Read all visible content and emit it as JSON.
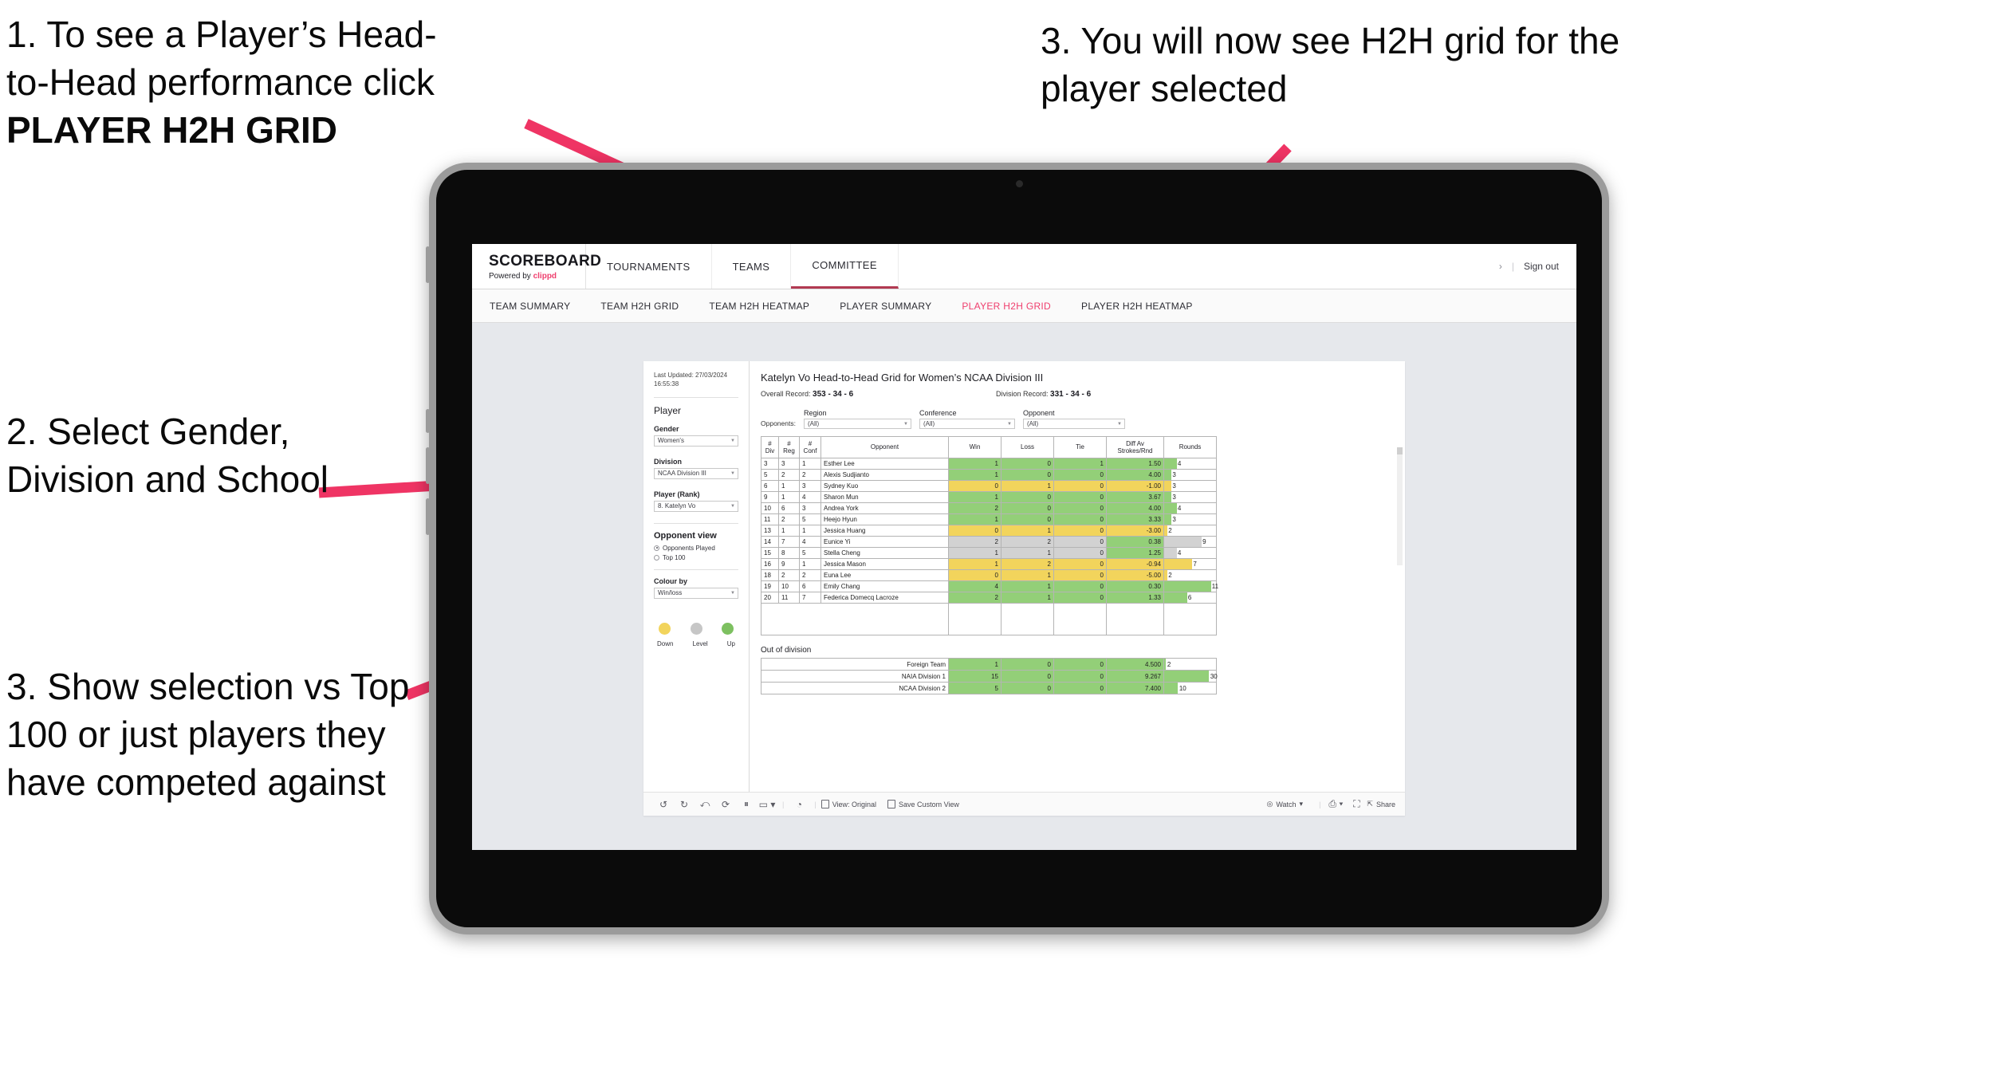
{
  "annotations": {
    "a1_line1": "1. To see a Player’s Head-",
    "a1_line2": "to-Head performance click",
    "a1_bold": "PLAYER H2H GRID",
    "a2": "2. Select Gender, Division and School",
    "a3": "3. Show selection vs Top 100 or just players they have competed against",
    "a4": "3. You will now see H2H grid for the player selected"
  },
  "colors": {
    "accent_pink": "#ef3e6d",
    "arrow_pink": "#ef3464",
    "win_green": "#93cf78",
    "loss_yellow": "#f2d45c",
    "tie_grey": "#d2d2d2",
    "active_tab": "#ef3e6d"
  },
  "browser": {
    "brand": {
      "logo": "SCOREBOARD",
      "powered_prefix": "Powered by ",
      "powered_brand": "clippd"
    },
    "topnav": [
      {
        "label": "TOURNAMENTS",
        "active": false
      },
      {
        "label": "TEAMS",
        "active": false
      },
      {
        "label": "COMMITTEE",
        "active": true
      }
    ],
    "signout": {
      "chevron": "›",
      "divider": "|",
      "label": "Sign out"
    },
    "subnav": [
      {
        "label": "TEAM SUMMARY",
        "active": false
      },
      {
        "label": "TEAM H2H GRID",
        "active": false
      },
      {
        "label": "TEAM H2H HEATMAP",
        "active": false
      },
      {
        "label": "PLAYER SUMMARY",
        "active": false
      },
      {
        "label": "PLAYER H2H GRID",
        "active": true
      },
      {
        "label": "PLAYER H2H HEATMAP",
        "active": false
      }
    ]
  },
  "rail": {
    "last_updated_line1": "Last Updated: 27/03/2024",
    "last_updated_line2": "16:55:38",
    "section_player": "Player",
    "filters": [
      {
        "label": "Gender",
        "value": "Women's"
      },
      {
        "label": "Division",
        "value": "NCAA Division III"
      },
      {
        "label": "Player (Rank)",
        "value": "8. Katelyn Vo"
      }
    ],
    "opponent_view": {
      "title": "Opponent view",
      "options": [
        {
          "label": "Opponents Played",
          "selected": true
        },
        {
          "label": "Top 100",
          "selected": false
        }
      ]
    },
    "colour_by": {
      "label": "Colour by",
      "value": "Win/loss"
    },
    "legend": [
      {
        "label": "Down",
        "color": "#f2d45c"
      },
      {
        "label": "Level",
        "color": "#c6c6c6"
      },
      {
        "label": "Up",
        "color": "#7dc060"
      }
    ]
  },
  "viz": {
    "title": "Katelyn Vo Head-to-Head Grid for Women’s NCAA Division III",
    "overall_record_label": "Overall Record: ",
    "overall_record_value": "353 -  34 - 6",
    "division_record_label": "Division Record: ",
    "division_record_value": "331 -  34 - 6",
    "opponents_label": "Opponents:",
    "opponent_filters": [
      {
        "label": "Region",
        "value": "(All)"
      },
      {
        "label": "Conference",
        "value": "(All)"
      },
      {
        "label": "Opponent",
        "value": "(All)"
      }
    ],
    "table_headers": {
      "div": "#\nDiv",
      "div_l1": "#",
      "div_l2": "Div",
      "reg_l1": "#",
      "reg_l2": "Reg",
      "conf_l1": "#",
      "conf_l2": "Conf",
      "opponent": "Opponent",
      "win": "Win",
      "loss": "Loss",
      "tie": "Tie",
      "diff_l1": "Diff Av",
      "diff_l2": "Strokes/Rnd",
      "rounds": "Rounds"
    },
    "rows": [
      {
        "div": "3",
        "reg": "3",
        "conf": "1",
        "opponent": "Esther Lee",
        "win": "1",
        "loss": "0",
        "tie": "1",
        "diff": "1.50",
        "rounds": "4",
        "color": "g",
        "rounds_pct": 24
      },
      {
        "div": "5",
        "reg": "2",
        "conf": "2",
        "opponent": "Alexis Sudjianto",
        "win": "1",
        "loss": "0",
        "tie": "0",
        "diff": "4.00",
        "rounds": "3",
        "color": "g",
        "rounds_pct": 14
      },
      {
        "div": "6",
        "reg": "1",
        "conf": "3",
        "opponent": "Sydney Kuo",
        "win": "0",
        "loss": "1",
        "tie": "0",
        "diff": "-1.00",
        "rounds": "3",
        "color": "y",
        "rounds_pct": 14
      },
      {
        "div": "9",
        "reg": "1",
        "conf": "4",
        "opponent": "Sharon Mun",
        "win": "1",
        "loss": "0",
        "tie": "0",
        "diff": "3.67",
        "rounds": "3",
        "color": "g",
        "rounds_pct": 14
      },
      {
        "div": "10",
        "reg": "6",
        "conf": "3",
        "opponent": "Andrea York",
        "win": "2",
        "loss": "0",
        "tie": "0",
        "diff": "4.00",
        "rounds": "4",
        "color": "g",
        "rounds_pct": 24
      },
      {
        "div": "11",
        "reg": "2",
        "conf": "5",
        "opponent": "Heejo Hyun",
        "win": "1",
        "loss": "0",
        "tie": "0",
        "diff": "3.33",
        "rounds": "3",
        "color": "g",
        "rounds_pct": 14
      },
      {
        "div": "13",
        "reg": "1",
        "conf": "1",
        "opponent": "Jessica Huang",
        "win": "0",
        "loss": "1",
        "tie": "0",
        "diff": "-3.00",
        "rounds": "2",
        "color": "y",
        "rounds_pct": 6
      },
      {
        "div": "14",
        "reg": "7",
        "conf": "4",
        "opponent": "Eunice Yi",
        "win": "2",
        "loss": "2",
        "tie": "0",
        "diff": "0.38",
        "rounds": "9",
        "color": "gr",
        "rounds_pct": 72,
        "diff_color": "g"
      },
      {
        "div": "15",
        "reg": "8",
        "conf": "5",
        "opponent": "Stella Cheng",
        "win": "1",
        "loss": "1",
        "tie": "0",
        "diff": "1.25",
        "rounds": "4",
        "color": "gr",
        "rounds_pct": 24,
        "diff_color": "g"
      },
      {
        "div": "16",
        "reg": "9",
        "conf": "1",
        "opponent": "Jessica Mason",
        "win": "1",
        "loss": "2",
        "tie": "0",
        "diff": "-0.94",
        "rounds": "7",
        "color": "y",
        "rounds_pct": 54
      },
      {
        "div": "18",
        "reg": "2",
        "conf": "2",
        "opponent": "Euna Lee",
        "win": "0",
        "loss": "1",
        "tie": "0",
        "diff": "-5.00",
        "rounds": "2",
        "color": "y",
        "rounds_pct": 6
      },
      {
        "div": "19",
        "reg": "10",
        "conf": "6",
        "opponent": "Emily Chang",
        "win": "4",
        "loss": "1",
        "tie": "0",
        "diff": "0.30",
        "rounds": "11",
        "color": "g",
        "rounds_pct": 90
      },
      {
        "div": "20",
        "reg": "11",
        "conf": "7",
        "opponent": "Federica Domecq Lacroze",
        "win": "2",
        "loss": "1",
        "tie": "0",
        "diff": "1.33",
        "rounds": "6",
        "color": "g",
        "rounds_pct": 44
      }
    ],
    "out_of_division": {
      "title": "Out of division",
      "rows": [
        {
          "name": "Foreign Team",
          "win": "1",
          "loss": "0",
          "tie": "0",
          "diff": "4.500",
          "rounds": "2",
          "color": "g",
          "rounds_pct": 3
        },
        {
          "name": "NAIA Division 1",
          "win": "15",
          "loss": "0",
          "tie": "0",
          "diff": "9.267",
          "rounds": "30",
          "color": "g",
          "rounds_pct": 86
        },
        {
          "name": "NCAA Division 2",
          "win": "5",
          "loss": "0",
          "tie": "0",
          "diff": "7.400",
          "rounds": "10",
          "color": "g",
          "rounds_pct": 26
        }
      ]
    },
    "toolbar": {
      "undo": "undo-icon",
      "redo": "redo-icon",
      "revert": "revert-icon",
      "refresh": "refresh-data-icon",
      "pause": "pause-updates-icon",
      "view_original": "View: Original",
      "save_custom_view": "Save Custom View",
      "watch": "Watch",
      "share": "Share"
    }
  }
}
